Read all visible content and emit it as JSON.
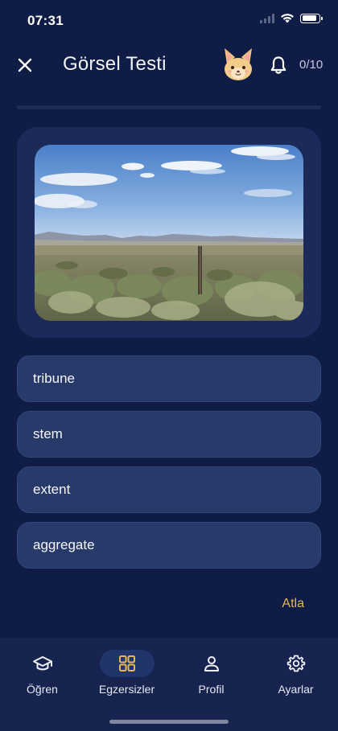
{
  "status_bar": {
    "time": "07:31",
    "battery_level": 0.85
  },
  "header": {
    "title": "Görsel Testi",
    "score": "0/10",
    "close_icon": "close-icon",
    "bell_icon": "bell-icon",
    "mascot": "fox-mascot-avatar"
  },
  "progress": {
    "value": 0.0
  },
  "question": {
    "image": "landscape-photo-sagebrush-desert"
  },
  "options": [
    {
      "label": "tribune"
    },
    {
      "label": "stem"
    },
    {
      "label": "extent"
    },
    {
      "label": "aggregate"
    }
  ],
  "skip_label": "Atla",
  "nav": {
    "active": "Egzersizler",
    "items": [
      {
        "label": "Öğren",
        "icon": "graduation-cap-icon"
      },
      {
        "label": "Egzersizler",
        "icon": "grid-icon"
      },
      {
        "label": "Profil",
        "icon": "person-icon"
      },
      {
        "label": "Ayarlar",
        "icon": "gear-icon"
      }
    ]
  },
  "colors": {
    "background": "#0f1c45",
    "card": "#1c2a5a",
    "option": "#283a6a",
    "accent": "#e8b84c",
    "nav": "#17244f"
  }
}
